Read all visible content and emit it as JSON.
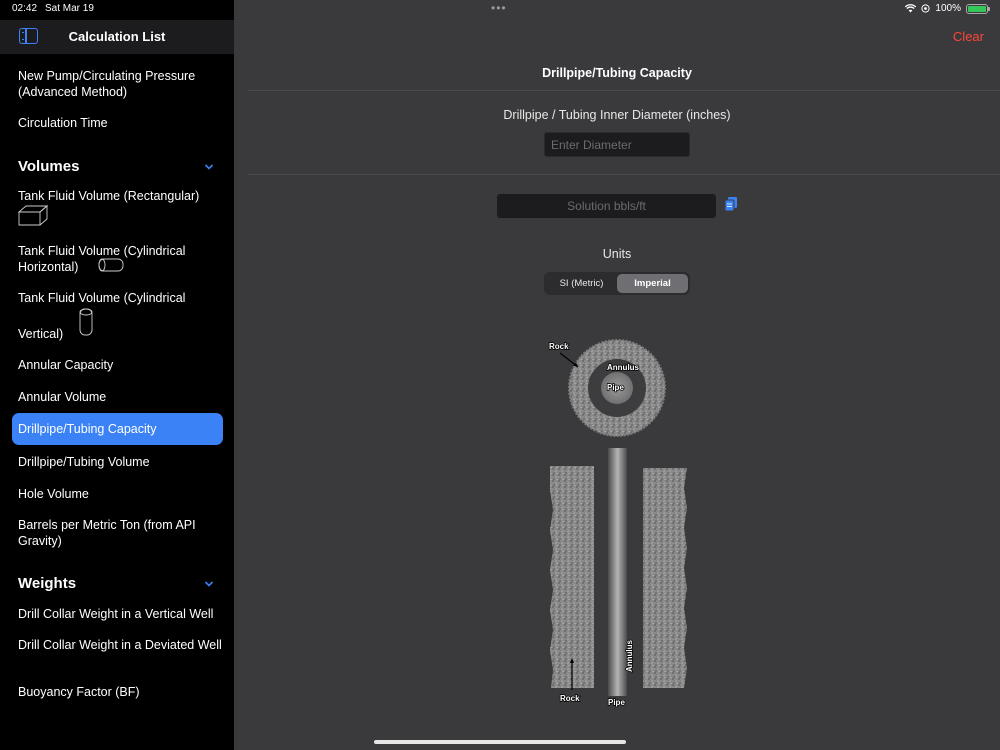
{
  "status_bar": {
    "time": "02:42",
    "date": "Sat Mar 19",
    "battery": "100%"
  },
  "sidebar": {
    "title": "Calculation List",
    "items_top": [
      {
        "label": "New Pump/Circulating Pressure (Advanced Method)"
      },
      {
        "label": "Circulation Time"
      }
    ],
    "sections": [
      {
        "header": "Volumes",
        "items": [
          {
            "label": "Tank Fluid Volume (Rectangular)"
          },
          {
            "label": "Tank Fluid Volume (Cylindrical Horizontal)"
          },
          {
            "label": "Tank Fluid Volume (Cylindrical Vertical)"
          },
          {
            "label": "Annular Capacity"
          },
          {
            "label": "Annular Volume"
          },
          {
            "label": "Drillpipe/Tubing Capacity"
          },
          {
            "label": "Drillpipe/Tubing Volume"
          },
          {
            "label": "Hole Volume"
          },
          {
            "label": "Barrels per Metric Ton (from API Gravity)"
          }
        ]
      },
      {
        "header": "Weights",
        "items": [
          {
            "label": "Drill Collar Weight in a Vertical Well"
          },
          {
            "label": "Drill Collar Weight in a Deviated Well"
          },
          {
            "label": "Buoyancy Factor (BF)"
          }
        ]
      }
    ],
    "cylindrical_vertical": {
      "line1": "Tank Fluid Volume (Cylindrical",
      "line2": "Vertical)"
    }
  },
  "main": {
    "clear_label": "Clear",
    "title": "Drillpipe/Tubing Capacity",
    "diameter_label": "Drillpipe / Tubing Inner Diameter (inches)",
    "diameter_placeholder": "Enter Diameter",
    "solution_placeholder": "Solution bbls/ft",
    "units_label": "Units",
    "units_options": [
      "SI (Metric)",
      "Imperial"
    ],
    "units_selected": "Imperial",
    "diagram_labels": {
      "rock": "Rock",
      "annulus": "Annulus",
      "pipe": "Pipe"
    }
  },
  "colors": {
    "accent": "#3b82f6",
    "clear": "#ff453a",
    "background": "#3a3a3c",
    "sidebar": "#000000"
  }
}
